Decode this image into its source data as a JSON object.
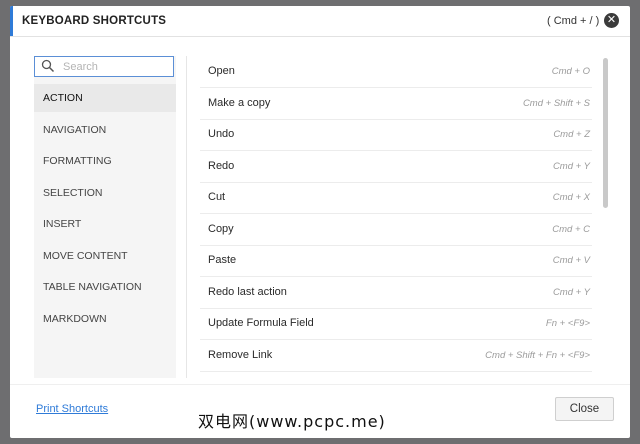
{
  "dialog": {
    "title": "KEYBOARD SHORTCUTS",
    "title_shortcut": "( Cmd + / )",
    "close_icon": "close-icon"
  },
  "search": {
    "placeholder": "Search",
    "value": ""
  },
  "categories": [
    {
      "label": "ACTION",
      "active": true
    },
    {
      "label": "NAVIGATION",
      "active": false
    },
    {
      "label": "FORMATTING",
      "active": false
    },
    {
      "label": "SELECTION",
      "active": false
    },
    {
      "label": "INSERT",
      "active": false
    },
    {
      "label": "MOVE CONTENT",
      "active": false
    },
    {
      "label": "TABLE NAVIGATION",
      "active": false
    },
    {
      "label": "MARKDOWN",
      "active": false
    }
  ],
  "shortcuts": [
    {
      "label": "Open",
      "keys": "Cmd + O"
    },
    {
      "label": "Make a copy",
      "keys": "Cmd + Shift + S"
    },
    {
      "label": "Undo",
      "keys": "Cmd + Z"
    },
    {
      "label": "Redo",
      "keys": "Cmd + Y"
    },
    {
      "label": "Cut",
      "keys": "Cmd + X"
    },
    {
      "label": "Copy",
      "keys": "Cmd + C"
    },
    {
      "label": "Paste",
      "keys": "Cmd + V"
    },
    {
      "label": "Redo last action",
      "keys": "Cmd + Y"
    },
    {
      "label": "Update Formula Field",
      "keys": "Fn + <F9>"
    },
    {
      "label": "Remove Link",
      "keys": "Cmd + Shift + Fn + <F9>"
    }
  ],
  "footer": {
    "print_label": "Print Shortcuts",
    "close_label": "Close"
  },
  "watermark": "双电网(www.pcpc.me)",
  "colors": {
    "accent": "#2f7bd8",
    "backdrop": "#6e6e70"
  }
}
